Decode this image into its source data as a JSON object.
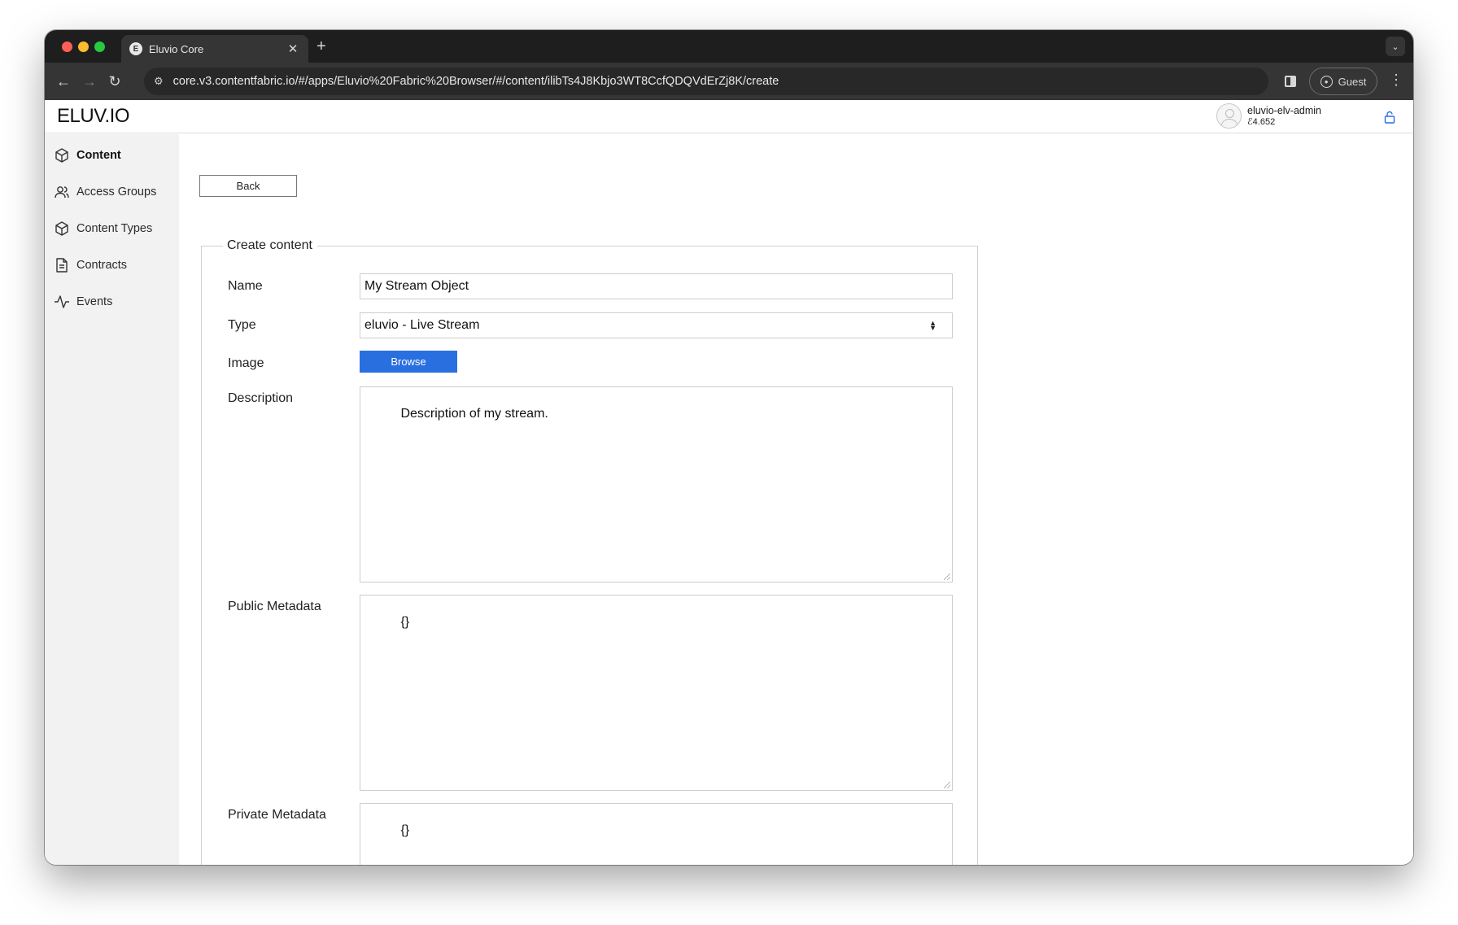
{
  "browser": {
    "tab_title": "Eluvio Core",
    "tab_favicon_letter": "E",
    "url": "core.v3.contentfabric.io/#/apps/Eluvio%20Fabric%20Browser/#/content/ilibTs4J8Kbjo3WT8CcfQDQVdErZj8K/create",
    "profile_label": "Guest"
  },
  "header": {
    "logo": "ELUV.IO",
    "account_name": "eluvio-elv-admin",
    "account_balance": "4.652",
    "balance_symbol": "ℰ"
  },
  "sidebar": {
    "items": [
      {
        "label": "Content",
        "icon": "cube-icon",
        "active": true
      },
      {
        "label": "Access Groups",
        "icon": "users-icon",
        "active": false
      },
      {
        "label": "Content Types",
        "icon": "cube-icon",
        "active": false
      },
      {
        "label": "Contracts",
        "icon": "document-icon",
        "active": false
      },
      {
        "label": "Events",
        "icon": "activity-icon",
        "active": false
      }
    ]
  },
  "form": {
    "back_label": "Back",
    "legend": "Create content",
    "name_label": "Name",
    "name_value": "My Stream Object",
    "type_label": "Type",
    "type_value": "eluvio - Live Stream",
    "image_label": "Image",
    "browse_label": "Browse",
    "description_label": "Description",
    "description_value": "Description of my stream.",
    "public_metadata_label": "Public Metadata",
    "public_metadata_value": "{}",
    "private_metadata_label": "Private Metadata",
    "private_metadata_value": "{}"
  },
  "colors": {
    "accent": "#2a6fdf",
    "browser_chrome": "#353535",
    "sidebar_bg": "#f2f2f2"
  }
}
